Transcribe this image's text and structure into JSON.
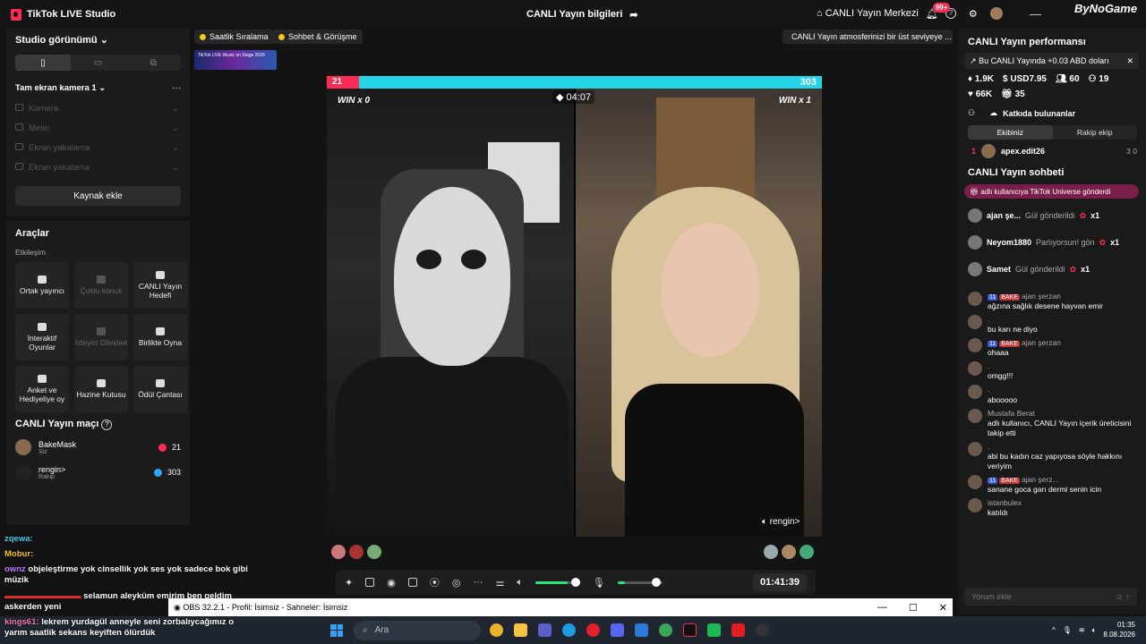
{
  "titlebar": {
    "app": "TikTok LIVE Studio",
    "center": "CANLI Yayın bilgileri",
    "live_center": "CANLI Yayın Merkezi",
    "notif_badge": "99+",
    "watermark": "ByNoGame"
  },
  "left": {
    "studio_view": "Studio görünümü",
    "camera": "Tam ekran kamera 1",
    "sources": [
      "Kamera",
      "Metin",
      "Ekran yakalama",
      "Ekran yakalama"
    ],
    "add_source": "Kaynak ekle",
    "tools_title": "Araçlar",
    "engagement": "Etkileşim",
    "tools": [
      {
        "label": "Ortak yayıncı",
        "dim": false
      },
      {
        "label": "Çoklu konuk",
        "dim": true
      },
      {
        "label": "CANLI Yayın Hedefi",
        "dim": false
      },
      {
        "label": "İnteraktif Oyunlar",
        "dim": false
      },
      {
        "label": "İzleyici Dilekleri",
        "dim": true
      },
      {
        "label": "Birlikte Oyna",
        "dim": false
      },
      {
        "label": "Anket ve Hediyeliye oy",
        "dim": false
      },
      {
        "label": "Hazine Kutusu",
        "dim": false
      },
      {
        "label": "Ödül Çantası",
        "dim": false
      }
    ],
    "match_title": "CANLI Yayın maçı",
    "players": [
      {
        "name": "BakeMask",
        "role": "Siz",
        "score": "21",
        "color": "#fe2c55"
      },
      {
        "name": "rengin>",
        "role": "Rakip",
        "score": "303",
        "color": "#2da8f5"
      }
    ]
  },
  "center": {
    "chip1": "Saatlik Sıralama",
    "chip2": "Sohbet & Görüşme",
    "chip3": "CANLI Yayın atmosferinizi bir üst seviyeye ...",
    "banner": "TikTok LIVE Music on Stage 2026",
    "score_left": "21",
    "score_right": "303",
    "score_left_fraction": 0.065,
    "timer": "04:07",
    "win_left": "WIN x 0",
    "win_right": "WIN x 1",
    "guest": "rengin>",
    "clock": "01:41:39"
  },
  "right": {
    "perf_title": "CANLI Yayın performansı",
    "income": "Bu CANLI Yayında +0.03 ABD doları",
    "stats1": [
      "1.9K",
      "USD7.95",
      "60",
      "19"
    ],
    "stats2": [
      "66K",
      "35"
    ],
    "contributors": "Katkıda bulunanlar",
    "tab_ours": "Ekibiniz",
    "tab_rival": "Rakip ekip",
    "rank": {
      "n": "1",
      "name": "apex.edit26",
      "v": "3   0"
    },
    "chat_title": "CANLI Yayın sohbeti",
    "system": "adlı kullanıcıya TikTok Universe gönderdi",
    "gifts": [
      {
        "name": "ajan şe...",
        "text": "Gül gönderildi",
        "count": "x1"
      },
      {
        "name": "Neyom1880",
        "text": "Parlıyorsun! gön",
        "count": "x1"
      },
      {
        "name": "Samet",
        "text": "Gül gönderildi",
        "count": "x1"
      }
    ],
    "messages": [
      {
        "name": "ajan şerzan",
        "text": "ağzına sağlık desene hayvan emir",
        "lvl": "11",
        "fan": "BAKE"
      },
      {
        "name": ".",
        "text": "bu karı ne diyo"
      },
      {
        "name": "ajan şerzan",
        "text": "ohaaa",
        "lvl": "11",
        "fan": "BAKE"
      },
      {
        "name": ".",
        "text": "omgg!!!"
      },
      {
        "name": ".",
        "text": "abooooo"
      },
      {
        "name": "Mustafa Berat",
        "text": "adlı kullanıcı, CANLI Yayın içerik üreticisini takip etti"
      },
      {
        "name": ".",
        "text": "abi bu kadın caz yapıyosa söyle hakkını veriyim"
      },
      {
        "name": "ajan şerz...",
        "text": "sanane goca garı dermi senin icin",
        "lvl": "11",
        "fan": "BAKE"
      },
      {
        "name": "istanbulex",
        "text": "katıldı"
      }
    ],
    "comment_placeholder": "Yorum ekle"
  },
  "overlay": [
    {
      "name": "zqewa:",
      "text": ""
    },
    {
      "name": "Mobur:",
      "text": ""
    },
    {
      "name": "ownz",
      "text": "objeleştirme yok cinsellik yok ses yok sadece bok gibi müzik"
    },
    {
      "name": "",
      "text": "selamun aleyküm emirim ben geldim askerden yeni"
    },
    {
      "name": "kings61:",
      "text": "lekrem yurdagül anneyle seni zorbalıycağımız o yarım saatlik sekans keyiften ölürdük"
    }
  ],
  "obs": "OBS 32.2.1 - Profil: İsimsiz - Sahneler: İsimsiz",
  "taskbar": {
    "search": "Ara",
    "time": "01:35",
    "date": "8.08.2026"
  }
}
